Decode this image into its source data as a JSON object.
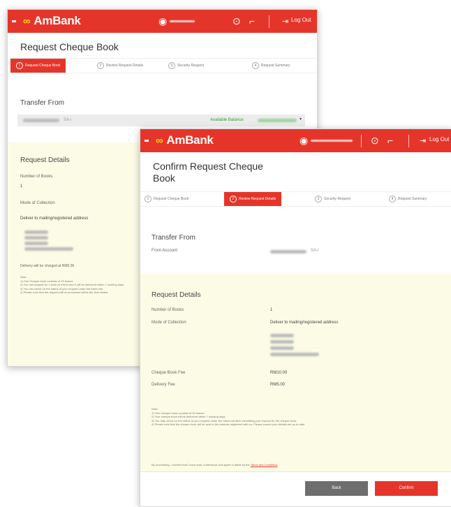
{
  "brand": {
    "name": "AmBank",
    "logout_label": "Log Out",
    "accent": "#e5352a",
    "logo_mark_color": "#ffd21a"
  },
  "win1": {
    "title": "Request Cheque Book",
    "steps": [
      {
        "num": "1",
        "label": "Request Cheque Book"
      },
      {
        "num": "2",
        "label": "Review Request Details"
      },
      {
        "num": "3",
        "label": "Security Request"
      },
      {
        "num": "4",
        "label": "Request Summary"
      }
    ],
    "transfer_from": "Transfer From",
    "account_suffix": "SA-i",
    "available_balance_label": "Available Balance",
    "request_details": "Request Details",
    "num_books_label": "Number of Books",
    "num_books_value": "1",
    "collection_label": "Mode of Collection",
    "collection_value": "Deliver to mailing/registered address",
    "fee_note": "Delivery will be charged at RM5.00",
    "notes_heading": "Note:",
    "notes": [
      "1) One Cheque book consists of 25 leaves.",
      "2) You can request for 1 book at a time and it will be delivered within 7 working days.",
      "3) You can check on the status of your request under the Inbox tab.",
      "4) Please note that the request will be processed within the time stated."
    ]
  },
  "win2": {
    "title": "Confirm Request Cheque Book",
    "steps": [
      {
        "num": "1",
        "label": "Request Cheque Book"
      },
      {
        "num": "2",
        "label": "Review Request Details"
      },
      {
        "num": "3",
        "label": "Security Request"
      },
      {
        "num": "4",
        "label": "Request Summary"
      }
    ],
    "transfer_from": "Transfer From",
    "from_account_label": "From Account",
    "account_suffix": "SA-i",
    "request_details": "Request Details",
    "num_books_label": "Number of Books",
    "num_books_value": "1",
    "collection_label": "Mode of Collection",
    "collection_value": "Deliver to mailing/registered address",
    "cheque_book_fee_label": "Cheque Book Fee",
    "cheque_book_fee_value": "RM10.00",
    "delivery_fee_label": "Delivery Fee",
    "delivery_fee_value": "RM5.00",
    "notes_heading": "Note:",
    "notes": [
      "1) One Cheque book consists of 25 leaves.",
      "2) Your cheque book will be delivered within 7 working days.",
      "3) You may check on the status of your request under the Inbox tab after submitting your request for the cheque book.",
      "4) Please note that the cheque book will be sent to the address registered with us. Please ensure your details are up to date."
    ],
    "terms_text": "By proceeding, I confirm that I have read, understood and agree to abide by the",
    "terms_link": "Terms and Conditions",
    "back_label": "Back",
    "confirm_label": "Confirm",
    "back_color": "#6e6e6e"
  }
}
